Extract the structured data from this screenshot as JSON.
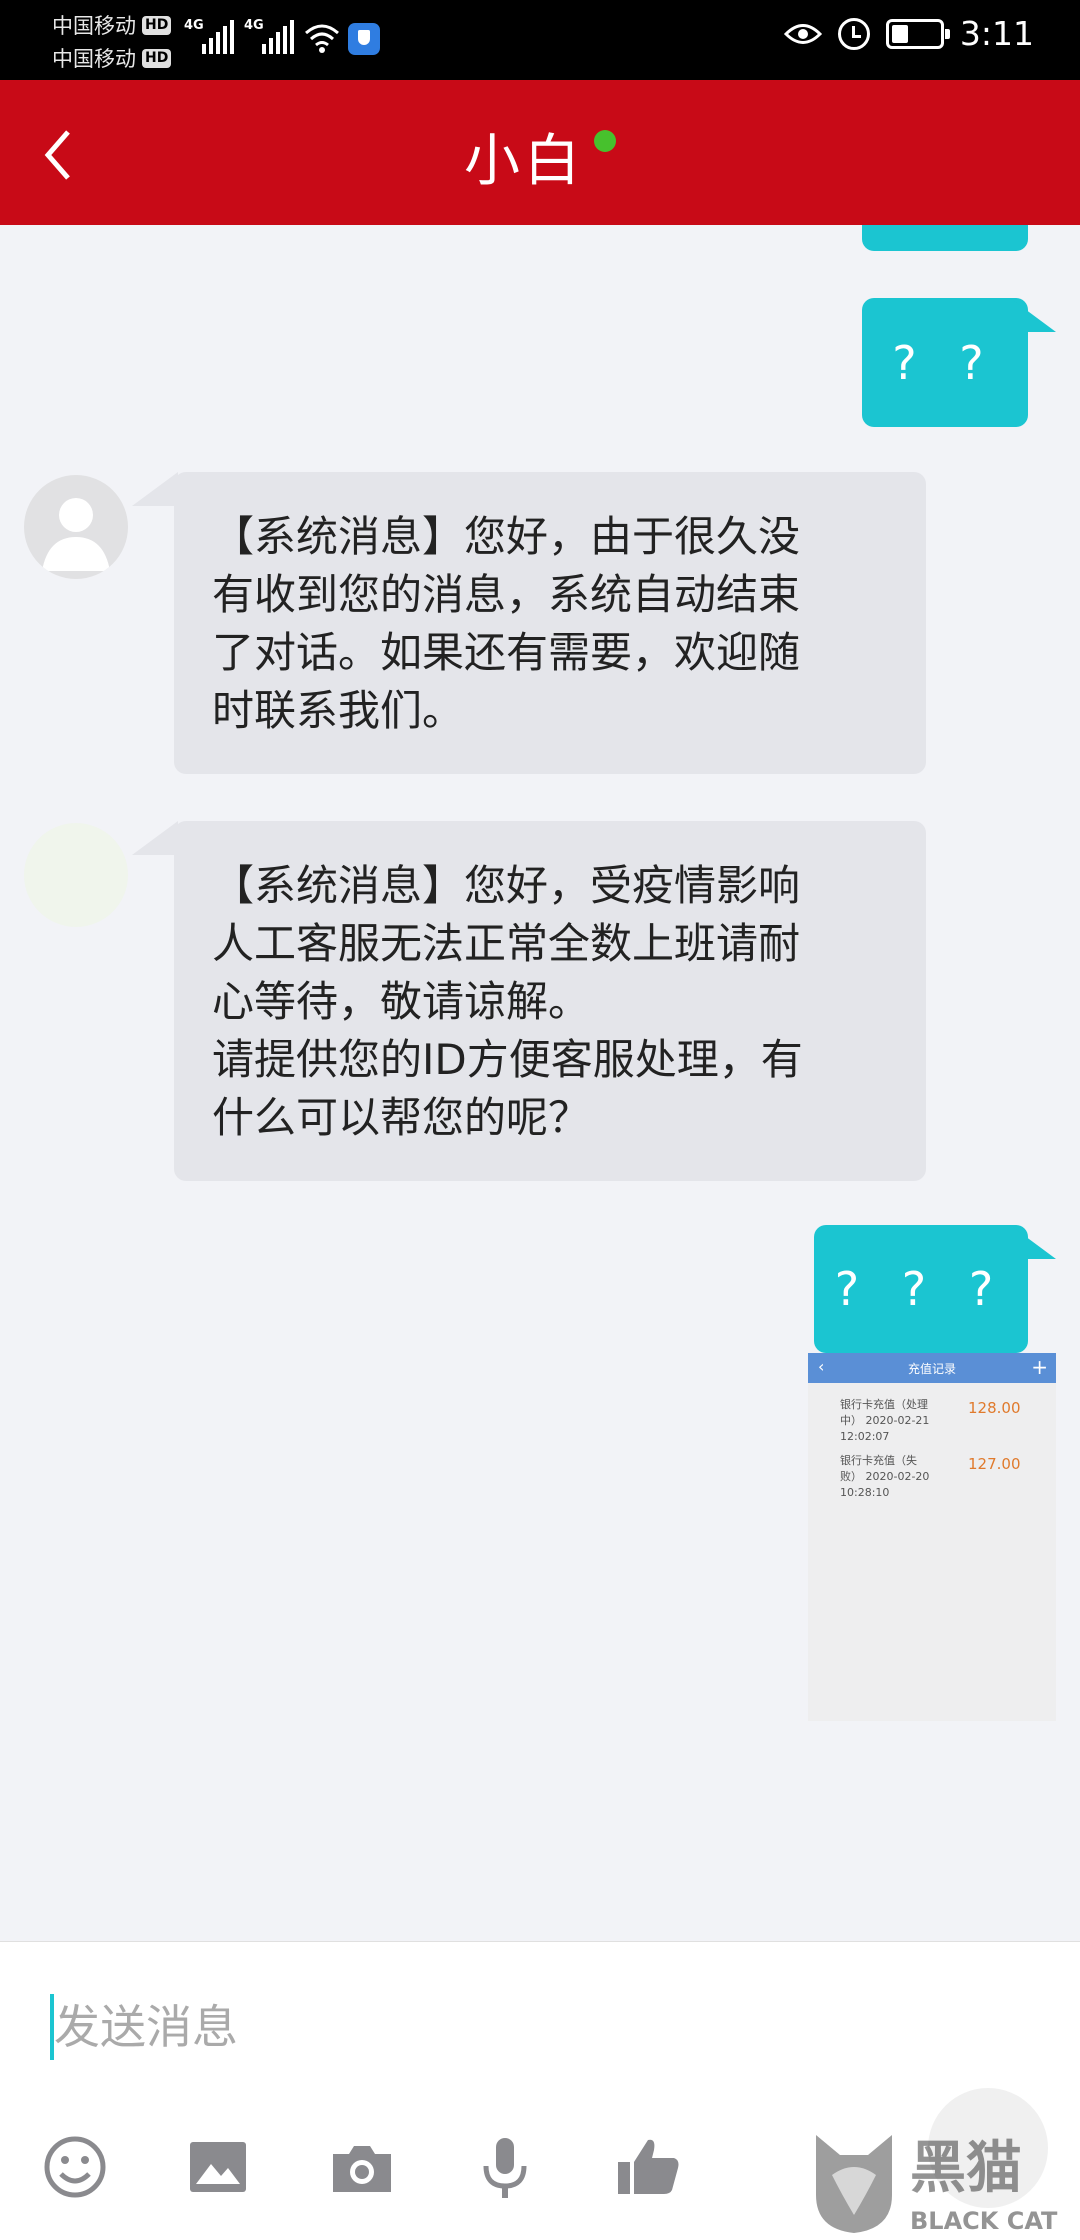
{
  "status_bar": {
    "carrier1": "中国移动",
    "carrier2": "中国移动",
    "hd_badge": "HD",
    "network_label": "4G",
    "time": "3:11"
  },
  "header": {
    "title": "小白",
    "online_color": "#47c12d",
    "accent": "#c80a17"
  },
  "messages": [
    {
      "side": "outgoing",
      "text": "? ?"
    },
    {
      "side": "incoming",
      "lines": [
        "【系统消息】您好，由于很久没",
        "有收到您的消息，系统自动结束",
        "了对话。如果还有需要，欢迎随",
        "时联系我们。"
      ]
    },
    {
      "side": "incoming",
      "lines": [
        "【系统消息】您好，受疫情影响",
        "人工客服无法正常全数上班请耐",
        "心等待，敬请谅解。",
        "请提供您的ID方便客服处理，有",
        "什么可以帮您的呢？"
      ]
    },
    {
      "side": "outgoing",
      "text": "? ? ?"
    },
    {
      "side": "outgoing",
      "text": "?"
    }
  ],
  "screenshot_thumb": {
    "title": "充值记录",
    "rows": [
      {
        "desc_lines": [
          "银行卡充值（处理",
          "中） 2020-02-21",
          "12:02:07"
        ],
        "amount": "128.00"
      },
      {
        "desc_lines": [
          "银行卡充值（失",
          "败） 2020-02-20",
          "10:28:10"
        ],
        "amount": "127.00"
      }
    ]
  },
  "input": {
    "placeholder": "发送消息"
  },
  "toolbar": [
    "emoji-icon",
    "image-icon",
    "camera-icon",
    "microphone-icon",
    "thumbs-up-icon"
  ],
  "watermark": {
    "brand_cn": "黑猫",
    "brand_en": "BLACK CAT"
  }
}
